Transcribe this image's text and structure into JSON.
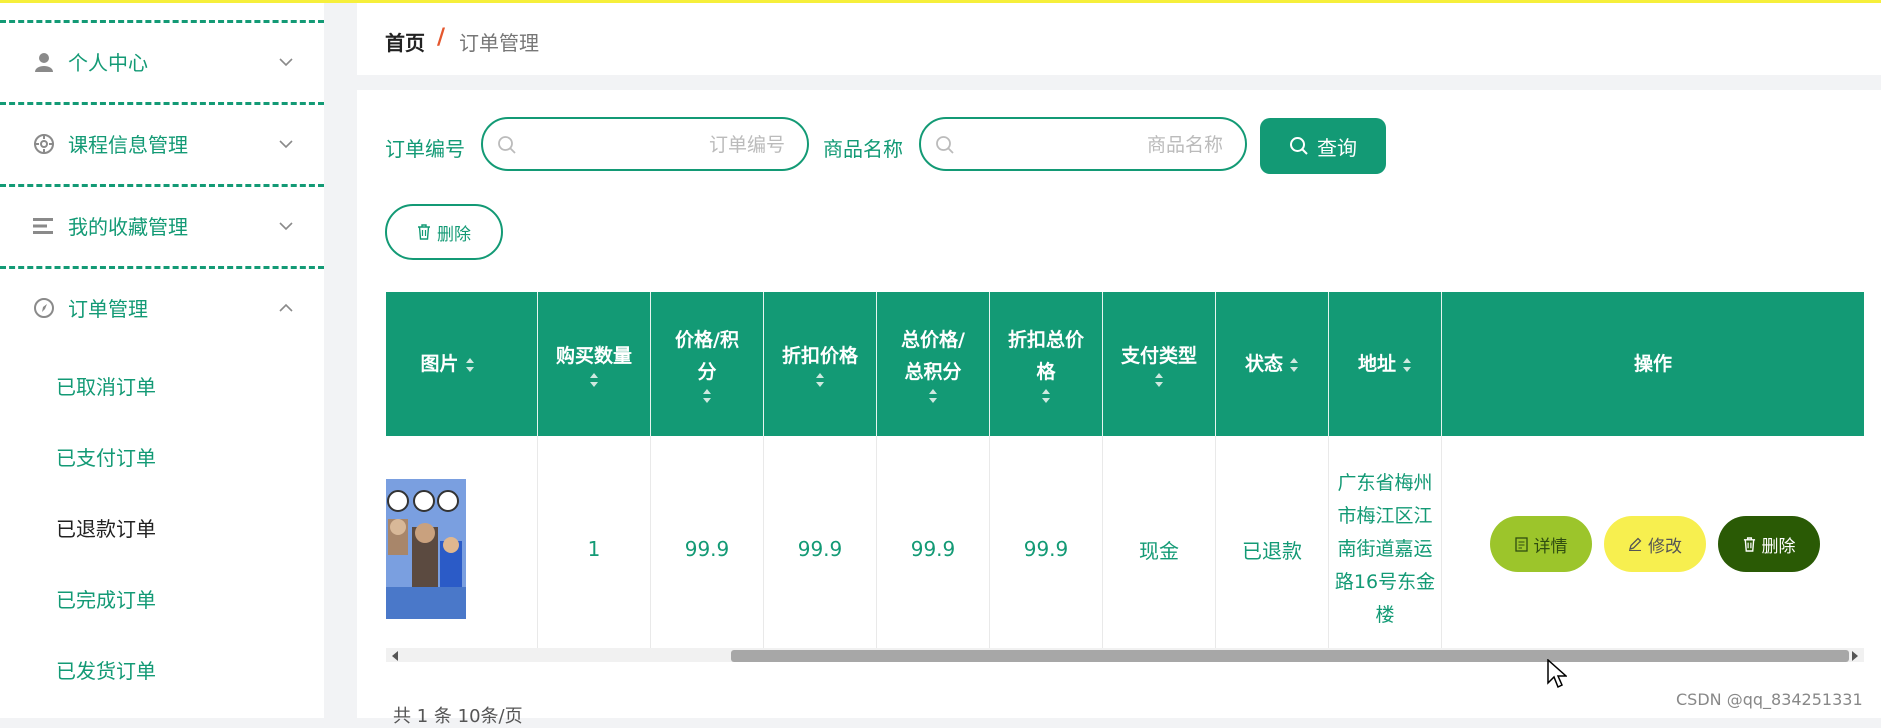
{
  "sidebar": {
    "menus": [
      {
        "label": "个人中心",
        "icon": "user-icon",
        "expanded": false
      },
      {
        "label": "课程信息管理",
        "icon": "target-icon",
        "expanded": false
      },
      {
        "label": "我的收藏管理",
        "icon": "list-icon",
        "expanded": false
      },
      {
        "label": "订单管理",
        "icon": "compass-icon",
        "expanded": true
      }
    ],
    "sub_items": [
      "已取消订单",
      "已支付订单",
      "已退款订单",
      "已完成订单",
      "已发货订单"
    ],
    "active_sub": "已退款订单"
  },
  "breadcrumb": {
    "home": "首页",
    "separator": "/",
    "current": "订单管理"
  },
  "search": {
    "order_no_label": "订单编号",
    "order_no_placeholder": "订单编号",
    "product_label": "商品名称",
    "product_placeholder": "商品名称",
    "query_button": "查询",
    "delete_button": "删除"
  },
  "table": {
    "headers": [
      "图片",
      "购买数量",
      "价格/积分",
      "折扣价格",
      "总价格/总积分",
      "折扣总价格",
      "支付类型",
      "状态",
      "地址",
      "操作"
    ],
    "rows": [
      {
        "quantity": "1",
        "price": "99.9",
        "discount_price": "99.9",
        "total_price": "99.9",
        "discount_total": "99.9",
        "pay_type": "现金",
        "status": "已退款",
        "address": "广东省梅州市梅江区江南街道嘉运路16号东金楼"
      }
    ],
    "actions": {
      "detail": "详情",
      "edit": "修改",
      "delete": "删除"
    }
  },
  "pager": {
    "text": "共 1 条   10条/页"
  },
  "watermark": "CSDN @qq_834251331",
  "colors": {
    "primary": "#139a75",
    "detail_btn": "#9cc52b",
    "edit_btn": "#f7ef4f",
    "delete_btn": "#2a5a05"
  }
}
